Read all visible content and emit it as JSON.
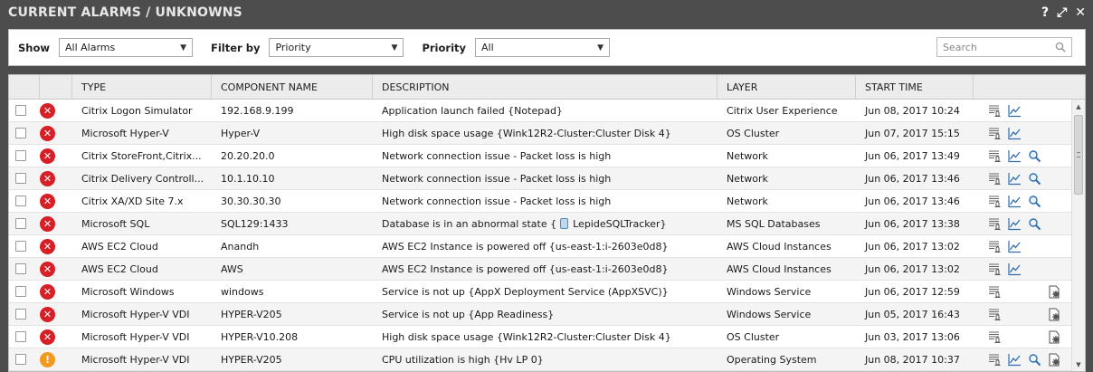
{
  "window": {
    "title": "CURRENT ALARMS / UNKNOWNS"
  },
  "titlebar_icons": {
    "help": "?",
    "expand": "⤢",
    "close": "✕"
  },
  "filters": {
    "show_label": "Show",
    "show_value": "All Alarms",
    "filterby_label": "Filter by",
    "filterby_value": "Priority",
    "priority_label": "Priority",
    "priority_value": "All",
    "search_placeholder": "Search"
  },
  "columns": [
    "",
    "",
    "TYPE",
    "COMPONENT NAME",
    "DESCRIPTION",
    "LAYER",
    "START TIME",
    ""
  ],
  "rows": [
    {
      "severity": "critical",
      "type": "Citrix Logon Simulator",
      "component": "192.168.9.199",
      "description": "Application launch failed {Notepad}",
      "layer": "Citrix User Experience",
      "start_time": "Jun 08, 2017 10:24",
      "actions": [
        "history",
        "graph"
      ]
    },
    {
      "severity": "critical",
      "type": "Microsoft Hyper-V",
      "component": "Hyper-V",
      "description": "High disk space usage {Wink12R2-Cluster:Cluster Disk 4}",
      "layer": "OS Cluster",
      "start_time": "Jun 07, 2017 15:15",
      "actions": [
        "history",
        "graph"
      ]
    },
    {
      "severity": "critical",
      "type": "Citrix StoreFront,Citrix...",
      "component": "20.20.20.0",
      "description": "Network connection issue - Packet loss is high",
      "layer": "Network",
      "start_time": "Jun 06, 2017 13:49",
      "actions": [
        "history",
        "graph",
        "search"
      ]
    },
    {
      "severity": "critical",
      "type": "Citrix Delivery Controll...",
      "component": "10.1.10.10",
      "description": "Network connection issue - Packet loss is high",
      "layer": "Network",
      "start_time": "Jun 06, 2017 13:46",
      "actions": [
        "history",
        "graph",
        "search"
      ]
    },
    {
      "severity": "critical",
      "type": "Citrix XA/XD Site 7.x",
      "component": "30.30.30.30",
      "description": "Network connection issue - Packet loss is high",
      "layer": "Network",
      "start_time": "Jun 06, 2017 13:46",
      "actions": [
        "history",
        "graph",
        "search"
      ]
    },
    {
      "severity": "critical",
      "type": "Microsoft SQL",
      "component": "SQL129:1433",
      "description_pre": "Database is in an abnormal state {",
      "description_post": "LepideSQLTracker}",
      "layer": "MS SQL Databases",
      "start_time": "Jun 06, 2017 13:38",
      "actions": [
        "history",
        "graph",
        "search"
      ]
    },
    {
      "severity": "critical",
      "type": "AWS EC2 Cloud",
      "component": "Anandh",
      "description": "AWS EC2 Instance is powered off {us-east-1:i-2603e0d8}",
      "layer": "AWS Cloud Instances",
      "start_time": "Jun 06, 2017 13:02",
      "actions": [
        "history",
        "graph"
      ]
    },
    {
      "severity": "critical",
      "type": "AWS EC2 Cloud",
      "component": "AWS",
      "description": "AWS EC2 Instance is powered off {us-east-1:i-2603e0d8}",
      "layer": "AWS Cloud Instances",
      "start_time": "Jun 06, 2017 13:02",
      "actions": [
        "history",
        "graph"
      ]
    },
    {
      "severity": "critical",
      "type": "Microsoft Windows",
      "component": "windows",
      "description": "Service is not up {AppX Deployment Service (AppXSVC)}",
      "layer": "Windows Service",
      "start_time": "Jun 06, 2017 12:59",
      "actions": [
        "history",
        "",
        "",
        "settings"
      ]
    },
    {
      "severity": "critical",
      "type": "Microsoft Hyper-V VDI",
      "component": "HYPER-V205",
      "description": "Service is not up {App Readiness}",
      "layer": "Windows Service",
      "start_time": "Jun 05, 2017 16:43",
      "actions": [
        "history",
        "",
        "",
        "settings"
      ]
    },
    {
      "severity": "critical",
      "type": "Microsoft Hyper-V VDI",
      "component": "HYPER-V10.208",
      "description": "High disk space usage {Wink12R2-Cluster:Cluster Disk 4}",
      "layer": "OS Cluster",
      "start_time": "Jun 03, 2017 13:06",
      "actions": [
        "history",
        "",
        "",
        "settings"
      ]
    },
    {
      "severity": "major",
      "type": "Microsoft Hyper-V VDI",
      "component": "HYPER-V205",
      "description": "CPU utilization is high {Hv LP 0}",
      "layer": "Operating System",
      "start_time": "Jun 08, 2017 10:37",
      "actions": [
        "history",
        "graph",
        "search",
        "settings"
      ]
    }
  ]
}
